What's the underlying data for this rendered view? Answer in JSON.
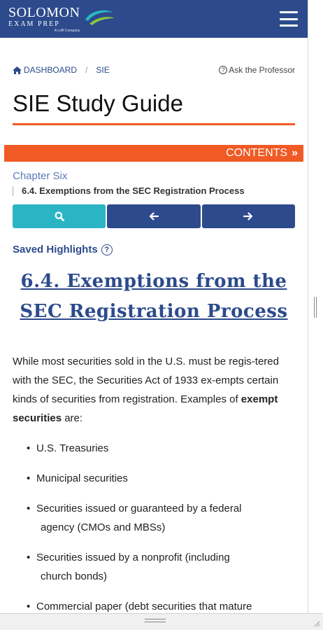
{
  "header": {
    "logo_main": "SOLOMON",
    "logo_sub": "EXAM PREP",
    "logo_tag": "A Leffi Company",
    "menu_icon": "hamburger-menu-icon"
  },
  "breadcrumb": {
    "home_icon": "home-icon",
    "dashboard": "DASHBOARD",
    "separator": "/",
    "current": "SIE",
    "ask_icon": "question-circle-icon",
    "ask_label": "Ask the Professor"
  },
  "page": {
    "title": "SIE Study Guide"
  },
  "contents": {
    "label": "CONTENTS",
    "chevron": "»"
  },
  "chapter": {
    "name": "Chapter Six",
    "section": "6.4. Exemptions from the SEC Registration Process"
  },
  "nav": {
    "search_icon": "search-icon",
    "prev_icon": "arrow-left-icon",
    "next_icon": "arrow-right-icon"
  },
  "saved": {
    "label": "Saved Highlights",
    "help_glyph": "?"
  },
  "content": {
    "heading": "6.4. Exemptions from the SEC Registration Process",
    "intro_start": "While most securities sold in the U.S. must be regis-tered with the SEC, the Securities Act of 1933 ex-empts certain kinds of securities from registration. Examples of ",
    "intro_bold": "exempt securities",
    "intro_end": " are:",
    "items": [
      {
        "line1": "U.S. Treasuries",
        "line2": ""
      },
      {
        "line1": "Municipal securities",
        "line2": ""
      },
      {
        "line1": "Securities issued or guaranteed by a federal",
        "line2": "agency (CMOs and MBSs)"
      },
      {
        "line1": "Securities issued by a nonprofit (including",
        "line2": "church bonds)"
      },
      {
        "line1": "Commercial paper (debt securities that mature",
        "line2": ""
      }
    ]
  },
  "colors": {
    "brand_navy": "#2c4a8c",
    "accent_orange": "#f15a24",
    "search_teal": "#2bb5c4"
  }
}
